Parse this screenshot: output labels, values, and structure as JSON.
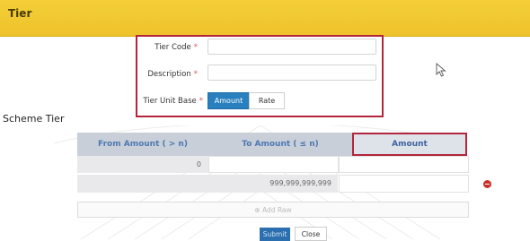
{
  "window": {
    "title": "Tier"
  },
  "form": {
    "tier_code_label": "Tier Code",
    "description_label": "Description",
    "tier_unit_base_label": "Tier Unit Base",
    "required_mark": "*",
    "tier_code_value": "",
    "description_value": "",
    "unit_base_options": [
      "Amount",
      "Rate"
    ],
    "unit_base_selected": "Amount"
  },
  "scheme": {
    "heading": "Scheme Tier",
    "columns": [
      "From Amount ( > n)",
      "To Amount ( ≤ n)",
      "Amount"
    ],
    "rows": [
      {
        "from": "0",
        "to": "",
        "amount": ""
      },
      {
        "from": "",
        "to": "999,999,999,999",
        "amount": ""
      }
    ],
    "add_row_label": "⊕ Add Raw"
  },
  "actions": {
    "submit_label": "Submit",
    "close_label": "Close"
  },
  "icons": {
    "remove_row": "minus-circle-icon",
    "cursor": "mouse-pointer-icon"
  },
  "colors": {
    "header": "#f2c831",
    "primary": "#2a7fbf",
    "highlight_border": "#b3253c",
    "remove": "#c9302c"
  }
}
